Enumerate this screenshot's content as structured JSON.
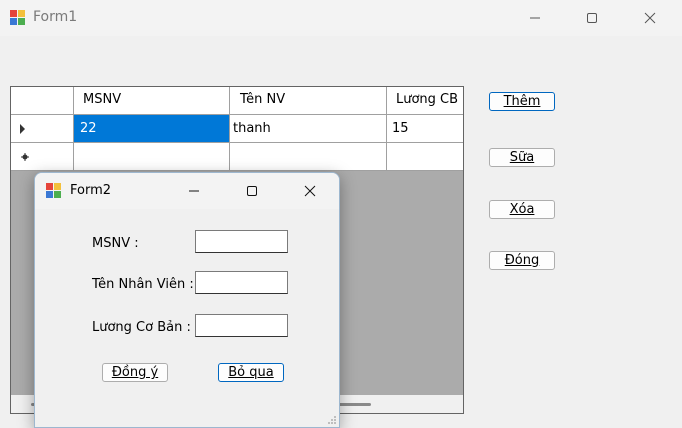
{
  "form1": {
    "title": "Form1",
    "grid": {
      "columns": [
        "MSNV",
        "Tên NV",
        "Lương CB"
      ],
      "rows": [
        {
          "indicator": "current-row-arrow",
          "msnv": "22",
          "ten_nv": "thanh",
          "luong_cb": "15"
        },
        {
          "indicator": "new-row-star",
          "msnv": "",
          "ten_nv": "",
          "luong_cb": ""
        }
      ]
    },
    "buttons": {
      "them": "Thêm",
      "sua": "Sữa",
      "xoa": "Xóa",
      "dong": "Đóng"
    }
  },
  "form2": {
    "title": "Form2",
    "labels": {
      "msnv": "MSNV :",
      "ten": "Tên Nhân Viên :",
      "luong": "Lương Cơ Bản :"
    },
    "inputs": {
      "msnv": "",
      "ten": "",
      "luong": ""
    },
    "buttons": {
      "dong_y": "Đồng ý",
      "bo_qua": "Bỏ qua"
    }
  },
  "colors": {
    "selection": "#0078d7",
    "focus_border": "#0067c0",
    "grid_background": "#ababab"
  },
  "icons": [
    "app-icon",
    "minimize-icon",
    "maximize-icon",
    "close-icon"
  ]
}
